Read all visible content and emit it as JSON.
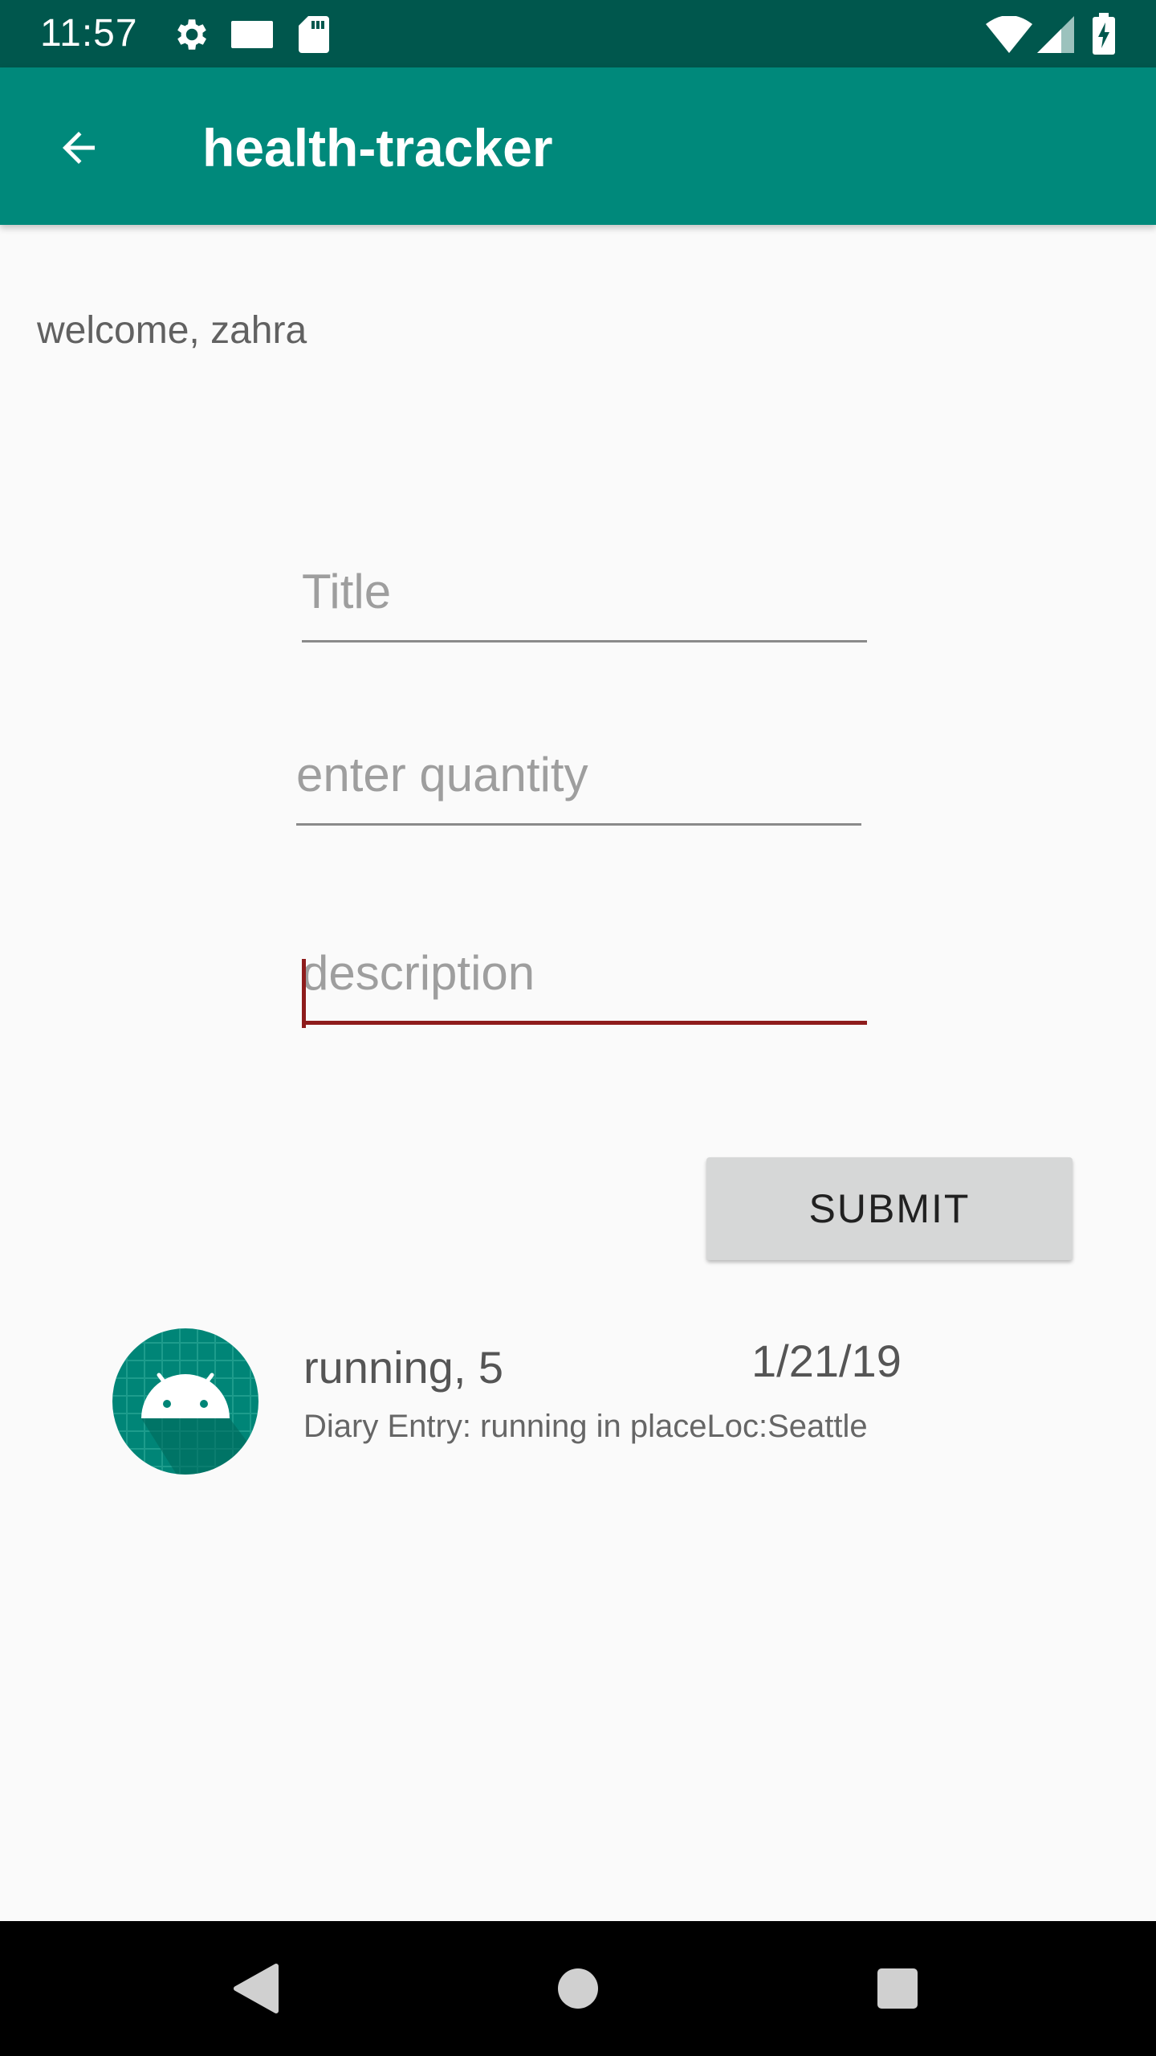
{
  "status_bar": {
    "time": "11:57",
    "icons": [
      "settings-icon",
      "notification-icon",
      "sd-card-icon",
      "wifi-icon",
      "signal-icon",
      "battery-icon"
    ]
  },
  "app_bar": {
    "title": "health-tracker",
    "back_icon": "arrow-back-icon",
    "color": "#00897b",
    "status_color": "#00574d"
  },
  "main": {
    "welcome": "welcome, zahra",
    "form": {
      "title_placeholder": "Title",
      "quantity_placeholder": "enter quantity",
      "description_placeholder": "description",
      "submit_label": "SUBMIT",
      "accent_color": "#8e1c1c"
    },
    "entries": [
      {
        "title": "running, 5",
        "date": "1/21/19",
        "description": "Diary Entry: running in placeLoc:Seattle",
        "icon": "android-icon"
      }
    ]
  },
  "nav_bar": {
    "icons": [
      "back-triangle-icon",
      "home-circle-icon",
      "recents-square-icon"
    ]
  }
}
